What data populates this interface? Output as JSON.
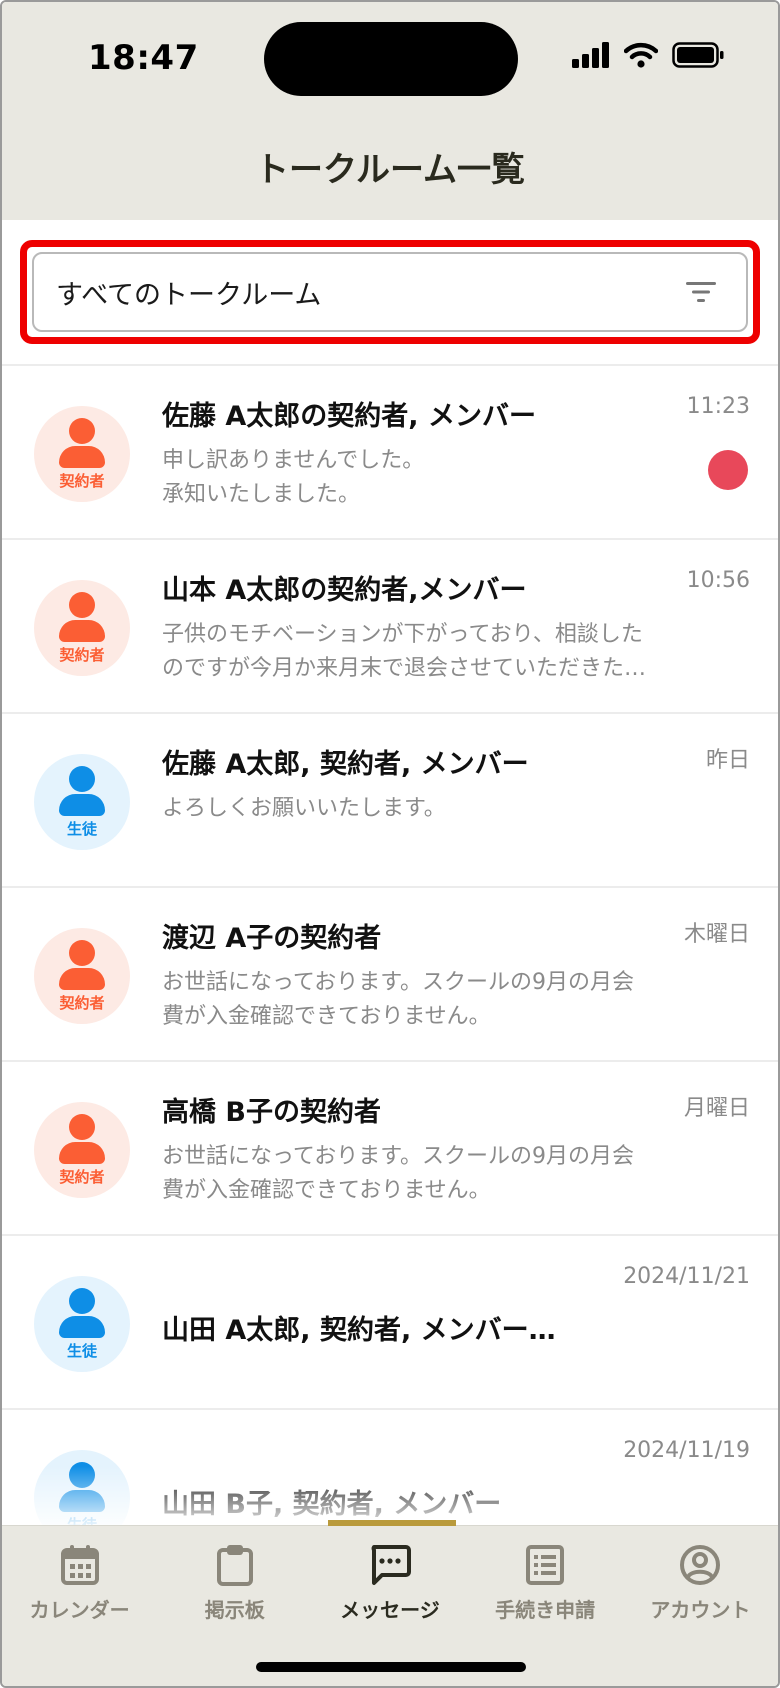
{
  "status_bar": {
    "time": "18:47"
  },
  "header": {
    "title": "トークルーム一覧"
  },
  "filter": {
    "label": "すべてのトークルーム",
    "icon": "filter-icon"
  },
  "rooms": [
    {
      "role": "契約者",
      "name": "佐藤 A太郎の契約者, メンバー",
      "preview": "申し訳ありませんでした。\n承知いたしました。",
      "time": "11:23",
      "unread": true
    },
    {
      "role": "契約者",
      "name": "山本 A太郎の契約者,メンバー",
      "preview": "子供のモチベーションが下がっており、相談したのですが今月か来月末で退会させていただきたいです。",
      "time": "10:56",
      "unread": false
    },
    {
      "role": "生徒",
      "name": "佐藤 A太郎, 契約者, メンバー",
      "preview": "よろしくお願いいたします。",
      "time": "昨日",
      "unread": false
    },
    {
      "role": "契約者",
      "name": "渡辺 A子の契約者",
      "preview": "お世話になっております。スクールの9月の月会費が入金確認できておりません。",
      "time": "木曜日",
      "unread": false
    },
    {
      "role": "契約者",
      "name": "高橋 B子の契約者",
      "preview": "お世話になっております。スクールの9月の月会費が入金確認できておりません。",
      "time": "月曜日",
      "unread": false
    },
    {
      "role": "生徒",
      "name": "山田 A太郎, 契約者, メンバー, 生徒",
      "preview": "",
      "time": "2024/11/21",
      "unread": false
    },
    {
      "role": "生徒",
      "name": "山田 B子, 契約者, メンバー",
      "preview": "",
      "time": "2024/11/19",
      "unread": false
    }
  ],
  "tabbar": {
    "items": [
      {
        "label": "カレンダー",
        "icon": "calendar-icon"
      },
      {
        "label": "掲示板",
        "icon": "clipboard-icon"
      },
      {
        "label": "メッセージ",
        "icon": "message-icon",
        "active": true
      },
      {
        "label": "手続き申請",
        "icon": "list-icon"
      },
      {
        "label": "アカウント",
        "icon": "account-icon"
      }
    ]
  },
  "colors": {
    "contract": "#fb5e34",
    "student": "#0e8ee6",
    "unread": "#e8485a",
    "highlight": "#ee0000",
    "tab_active_bar": "#b99a3c"
  }
}
